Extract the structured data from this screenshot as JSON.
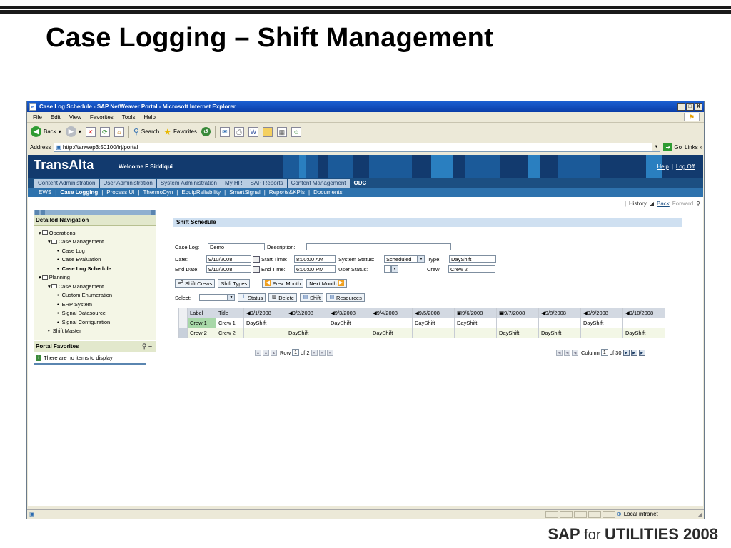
{
  "slide": {
    "title": "Case Logging – Shift Management",
    "footer_sap": "SAP",
    "footer_for": " for ",
    "footer_util": "UTILITIES 2008"
  },
  "window": {
    "title": "Case Log Schedule - SAP NetWeaver Portal - Microsoft Internet Explorer",
    "min": "_",
    "max": "□",
    "close": "X"
  },
  "menu": [
    "File",
    "Edit",
    "View",
    "Favorites",
    "Tools",
    "Help"
  ],
  "toolbar": {
    "back": "Back",
    "search": "Search",
    "favorites": "Favorites"
  },
  "address": {
    "label": "Address",
    "url": "http://tanwep3:50100/irj/portal",
    "go": "Go",
    "links": "Links"
  },
  "portal": {
    "logo": "TransAlta",
    "welcome": "Welcome F Siddiqui",
    "help": "Help",
    "logoff": "Log Off",
    "top_tabs": [
      "Content Administration",
      "User Administration",
      "System Administration",
      "My HR",
      "SAP Reports",
      "Content Management",
      "ODC"
    ],
    "sub_tabs": [
      "EWS",
      "Case Logging",
      "Process UI",
      "ThermoDyn",
      "EquipReliability",
      "SmartSignal",
      "Reports&KPIs",
      "Documents"
    ],
    "history": "History",
    "back": "Back",
    "forward": "Forward"
  },
  "nav": {
    "title": "Detailed Navigation",
    "items": [
      "Operations",
      "Case Management",
      "Case Log",
      "Case Evaluation",
      "Case Log Schedule",
      "Planning",
      "Case Management",
      "Custom Enumeration",
      "ERP System",
      "Signal Datasource",
      "Signal Configuration",
      "Shift Master"
    ],
    "fav_title": "Portal Favorites",
    "fav_empty": "There are no items to display"
  },
  "schedule": {
    "title": "Shift Schedule",
    "case_log_label": "Case Log:",
    "case_log": "Demo",
    "description_label": "Description:",
    "description": "",
    "date_label": "Date:",
    "date": "9/10/2008",
    "start_time_label": "Start Time:",
    "start_time": "8:00:00 AM",
    "system_status_label": "System Status:",
    "system_status": "Scheduled",
    "type_label": "Type:",
    "type": "DayShift",
    "end_date_label": "End Date:",
    "end_date": "9/10/2008",
    "end_time_label": "End Time:",
    "end_time": "6:00:00 PM",
    "user_status_label": "User Status:",
    "user_status": "",
    "crew_label": "Crew:",
    "crew": "Crew 2",
    "btn_shift_crews": "Shift Crews",
    "btn_shift_types": "Shift Types",
    "btn_prev_month": "Prev. Month",
    "btn_next_month": "Next Month",
    "select_label": "Select:",
    "select_value": "",
    "btn_status": "Status",
    "btn_delete": "Delete",
    "btn_shift": "Shift",
    "btn_resources": "Resources",
    "columns": [
      "Label",
      "Title",
      "9/1/2008",
      "9/2/2008",
      "9/3/2008",
      "9/4/2008",
      "9/5/2008",
      "9/6/2008",
      "9/7/2008",
      "9/8/2008",
      "9/9/2008",
      "9/10/2008"
    ],
    "rows": [
      [
        "Crew 1",
        "Crew 1",
        "DayShift",
        "",
        "DayShift",
        "",
        "DayShift",
        "DayShift",
        "",
        "",
        "DayShift",
        ""
      ],
      [
        "Crew 2",
        "Crew 2",
        "",
        "DayShift",
        "",
        "DayShift",
        "",
        "",
        "DayShift",
        "DayShift",
        "",
        "DayShift"
      ]
    ],
    "row_label": "Row",
    "row_value": "1",
    "row_of": "of 2",
    "col_label": "Column",
    "col_value": "1",
    "col_of": "of 30"
  },
  "status": {
    "zone": "Local intranet"
  }
}
